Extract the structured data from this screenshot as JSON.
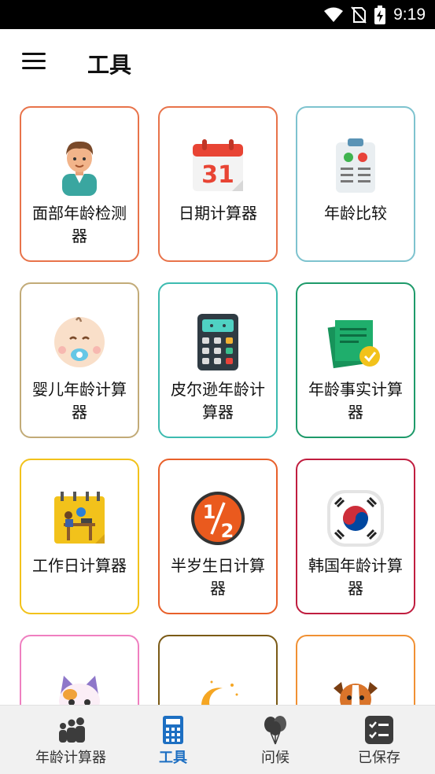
{
  "status_bar": {
    "time": "9:19"
  },
  "app_bar": {
    "title": "工具"
  },
  "tools": [
    {
      "label": "面部年龄检测器",
      "border": "#e8734a",
      "icon": "face-boy-icon"
    },
    {
      "label": "日期计算器",
      "border": "#e8734a",
      "icon": "calendar-31-icon"
    },
    {
      "label": "年龄比较",
      "border": "#7ec3cf",
      "icon": "clipboard-compare-icon"
    },
    {
      "label": "婴儿年龄计算器",
      "border": "#c2ab78",
      "icon": "baby-face-icon"
    },
    {
      "label": "皮尔逊年龄计算器",
      "border": "#3dbbb0",
      "icon": "calculator-icon"
    },
    {
      "label": "年龄事实计算器",
      "border": "#1e9a6a",
      "icon": "certificate-icon"
    },
    {
      "label": "工作日计算器",
      "border": "#f2c21b",
      "icon": "workday-calendar-icon"
    },
    {
      "label": "半岁生日计算器",
      "border": "#e8602a",
      "icon": "half-fraction-icon"
    },
    {
      "label": "韩国年龄计算器",
      "border": "#c01d3f",
      "icon": "korea-flag-icon"
    },
    {
      "label": "",
      "border": "#ef7fc0",
      "icon": "cat-icon"
    },
    {
      "label": "",
      "border": "#7a5a16",
      "icon": "moon-icon"
    },
    {
      "label": "",
      "border": "#f09033",
      "icon": "dog-icon"
    }
  ],
  "bottom_nav": [
    {
      "label": "年龄计算器",
      "icon": "family-icon",
      "active": false
    },
    {
      "label": "工具",
      "icon": "calculator-icon",
      "active": true
    },
    {
      "label": "问候",
      "icon": "balloons-icon",
      "active": false
    },
    {
      "label": "已保存",
      "icon": "checklist-icon",
      "active": false
    }
  ],
  "colors": {
    "accent": "#1d6fc2",
    "nav_background": "#f1f1f1",
    "status_bar": "#000000"
  }
}
